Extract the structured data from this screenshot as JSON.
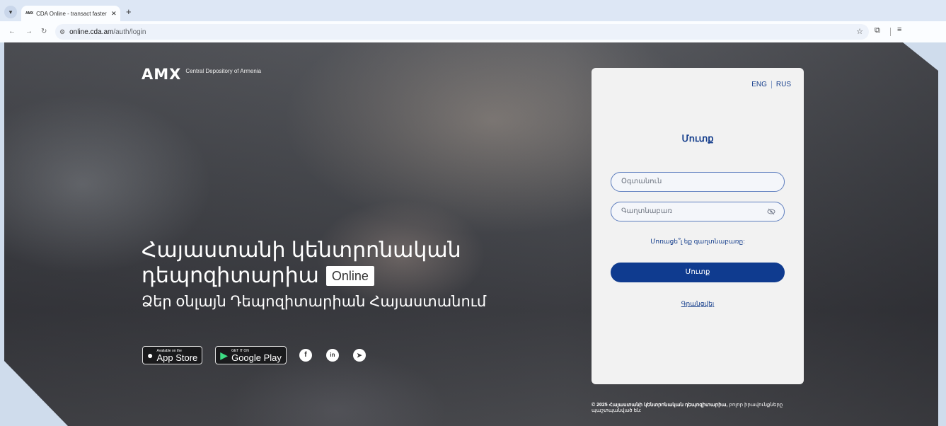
{
  "browser": {
    "tab_title": "CDA Online - transact faster, vi",
    "tab_favicon": "AMX",
    "url_prefix": "online.cda.am",
    "url_path": "/auth/login"
  },
  "brand": {
    "logo_mark": "AMX",
    "logo_text": "Central Depository of Armenia"
  },
  "hero": {
    "line1": "Հայաստանի կենտրոնական",
    "line2": "դեպոզիտարիա",
    "badge": "Online",
    "line3": "Ձեր օնլայն Դեպոզիտարիան Հայաստանում"
  },
  "stores": {
    "appstore_small": "Available on the",
    "appstore_big": "App Store",
    "google_small": "GET IT ON",
    "google_big": "Google Play"
  },
  "social": {
    "facebook": "f",
    "linkedin": "in",
    "telegram": "➤"
  },
  "login": {
    "lang_eng": "ENG",
    "lang_rus": "RUS",
    "title": "Մուտք",
    "username_placeholder": "Օգտանուն",
    "password_placeholder": "Գաղտնաբառ",
    "forgot": "Մոռացե՞լ եք գաղտնաբառը:",
    "submit": "Մուտք",
    "register": "Գրանցվել"
  },
  "footer": {
    "bold": "© 2025 Հայաստանի կենտրոնական դեպոզիտարիա,",
    "rest": "բոլոր իրավունքները պաշտպանված են:"
  },
  "colors": {
    "accent": "#0f3b8f",
    "link": "#153e8c"
  },
  "icons": {
    "eye_off": "eye-off-icon",
    "star": "bookmark-star-icon"
  }
}
